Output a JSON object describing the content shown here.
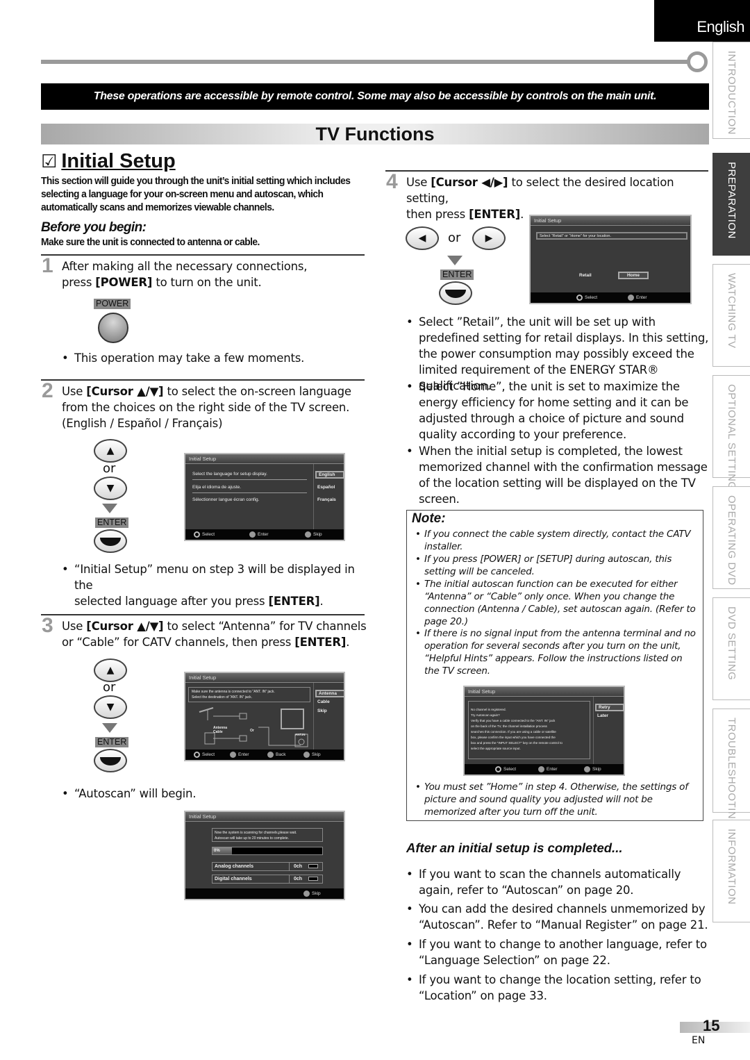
{
  "header": {
    "language_tab": "English",
    "banner": "These operations are accessible by remote control. Some may also be accessible by controls on the main unit.",
    "title": "TV Functions"
  },
  "side_tabs": [
    {
      "label": "INTRODUCTION",
      "active": false
    },
    {
      "label": "PREPARATION",
      "active": true
    },
    {
      "label": "WATCHING  TV",
      "active": false
    },
    {
      "label": "OPTIONAL  SETTING",
      "active": false
    },
    {
      "label": "OPERATING  DVD",
      "active": false
    },
    {
      "label": "DVD  SETTING",
      "active": false
    },
    {
      "label": "TROUBLESHOOTING",
      "active": false
    },
    {
      "label": "INFORMATION",
      "active": false
    }
  ],
  "section": {
    "checkbox_icon": "☑",
    "heading": "Initial Setup",
    "intro_lines": [
      "This section will guide you through the unit’s initial setting which includes",
      "selecting a language for your on-screen menu and autoscan, which",
      "automatically scans and memorizes viewable channels."
    ],
    "before_heading": "Before you begin:",
    "before_text": "Make sure the unit is connected to antenna or cable."
  },
  "steps": {
    "step1": {
      "num": "1",
      "line1": "After making all the necessary connections,",
      "line2_pre": "press ",
      "line2_key": "[POWER]",
      "line2_post": " to turn on the unit.",
      "key_label": "POWER",
      "bullet": "This operation may take a few moments."
    },
    "step2": {
      "num": "2",
      "line1_pre": "Use ",
      "line1_key": "[Cursor ▲/▼]",
      "line1_post": " to select the on-screen language",
      "line2": "from the choices on the right side of the TV screen.",
      "line3": "(English / Español / Français)",
      "or": "or",
      "enter_label": "ENTER",
      "bullet_line1": "“Initial Setup” menu on step 3 will be displayed in the",
      "bullet_line2_pre": "selected language after you press ",
      "bullet_line2_key": "[ENTER]",
      "bullet_line2_post": "."
    },
    "step3": {
      "num": "3",
      "line1_pre": "Use ",
      "line1_key": "[Cursor ▲/▼]",
      "line1_post": " to select “Antenna” for TV channels",
      "line2_pre": "or “Cable” for CATV channels, then press ",
      "line2_key": "[ENTER]",
      "line2_post": ".",
      "or": "or",
      "enter_label": "ENTER",
      "bullet": "“Autoscan” will begin."
    },
    "step4": {
      "num": "4",
      "line1_pre": "Use ",
      "line1_key": "[Cursor ◀/▶]",
      "line1_post": " to select the desired location setting,",
      "line2_pre": "then press ",
      "line2_key": "[ENTER]",
      "line2_post": ".",
      "or": "or",
      "enter_label": "ENTER",
      "bullets": [
        "Select ”Retail”, the unit will be set up with predefined setting for retail displays. In this setting, the power consumption may possibly exceed the limited requirement of the ENERGY STAR® qualification.",
        "Select ”Home”, the unit is set to maximize the energy efficiency for home setting and it can be adjusted through a choice of picture and sound quality according to your preference.",
        "When the initial setup is completed, the lowest memorized channel with the confirmation message of the location setting will be displayed on the TV screen."
      ]
    }
  },
  "screens": {
    "language": {
      "title": "Initial Setup",
      "rows": [
        "Select the language for setup display.",
        "Elija el idioma de ajuste.",
        "Sélectionner langue écran config."
      ],
      "options": [
        "English",
        "Español",
        "Français"
      ],
      "selected": "English",
      "footer": {
        "select": "Select",
        "enter": "Enter",
        "skip": "Skip",
        "skip_key": "SETUP"
      }
    },
    "antenna": {
      "title": "Initial Setup",
      "msg1": "Make sure the antenna is connected to “ANT. IN” jack.",
      "msg2": "Select the destination of “ANT. IN” jack.",
      "options": [
        "Antenna",
        "Cable",
        "Skip"
      ],
      "selected": "Antenna",
      "diagram_labels": {
        "antenna": "Antenna",
        "cable": "Cable",
        "or": "Or",
        "antin": "ANT.IN"
      },
      "footer": {
        "select": "Select",
        "enter": "Enter",
        "back": "Back",
        "back_key": "BACK",
        "skip": "Skip",
        "skip_key": "SETUP"
      }
    },
    "scan": {
      "title": "Initial Setup",
      "msg1": "Now the system is scanning for channels,please wait.",
      "msg2": "Autoscan will take up to 20 minutes to complete.",
      "progress_label": "0%",
      "progress_value": 0,
      "analog_label": "Analog channels",
      "analog_value": "0ch",
      "digital_label": "Digital channels",
      "digital_value": "0ch",
      "footer": {
        "skip": "Skip",
        "skip_key": "SETUP"
      }
    },
    "location": {
      "title": "Initial Setup",
      "msg": "Select “Retail” or “Home” for your location.",
      "options": [
        "Retail",
        "Home"
      ],
      "selected": "Home",
      "footer": {
        "select": "Select",
        "enter": "Enter"
      }
    },
    "nochannel": {
      "title": "Initial Setup",
      "lines": [
        "No channel is registered.",
        "Try Autoscan again?",
        "Verify that you have a cable connected to the “ANT. IN” jack",
        "on the back of the TV, the channel installation process",
        "searches this connection. If you are using a cable or satellite",
        "box, please confirm the input which you have connected the",
        "box and press the “INPUT SELECT” key on the remote control to",
        "select the appropriate source input."
      ],
      "options": [
        "Retry",
        "Later"
      ],
      "selected": "Retry",
      "footer": {
        "select": "Select",
        "enter": "Enter",
        "skip": "Skip",
        "skip_key": "SETUP"
      }
    }
  },
  "note": {
    "heading": "Note:",
    "items": [
      "If you connect the cable system directly, contact the CATV installer.",
      "If you press  [POWER]  or [SETUP] during autoscan, this setting will be canceled.",
      "The initial autoscan function can be executed for either “Antenna” or “Cable” only once. When you change the connection (Antenna / Cable), set autoscan again. (Refer to page 20.)",
      "If there is no signal input from the antenna terminal and no operation for several seconds after you turn on the unit, “Helpful Hints” appears. Follow the instructions listed on the TV screen."
    ],
    "last_item": "You must set ”Home” in step 4. Otherwise, the settings of picture and sound quality you adjusted will not be memorized after you turn off the unit."
  },
  "after": {
    "heading": "After an initial setup is completed...",
    "items": [
      "If you want to scan the channels automatically again, refer to “Autoscan” on page 20.",
      "You can add the desired channels unmemorized by “Autoscan”. Refer to “Manual Register” on page 21.",
      "If you want to change to another language, refer to “Language Selection” on page 22.",
      "If you want to change the location setting, refer to “Location” on page 33."
    ]
  },
  "footer": {
    "page_number": "15",
    "lang_code": "EN"
  }
}
